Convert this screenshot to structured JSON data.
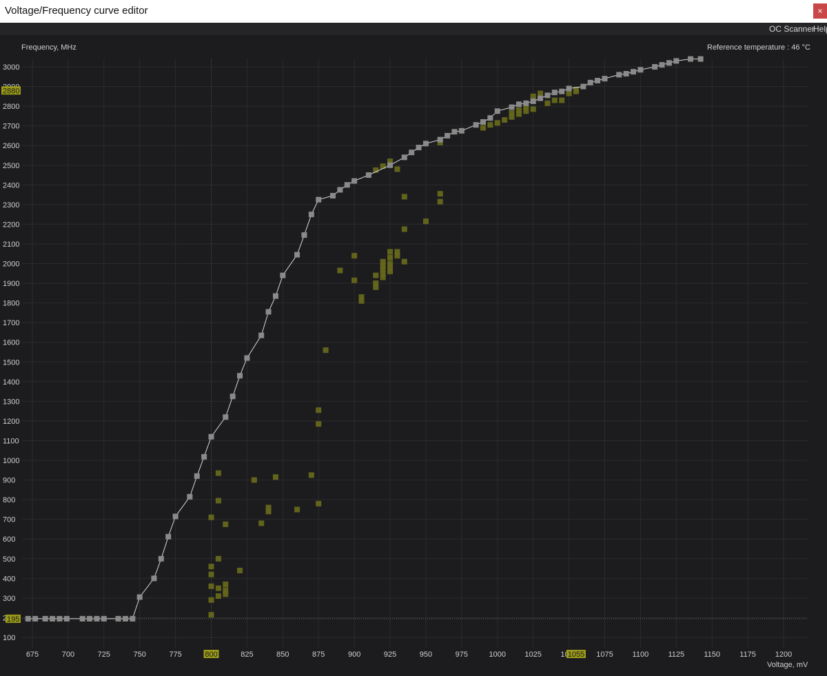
{
  "window": {
    "title": "Voltage/Frequency curve editor",
    "close_label": "×"
  },
  "menu": {
    "items": [
      "OC Scanner",
      "Help"
    ]
  },
  "chart_data": {
    "type": "scatter",
    "ylabel": "Frequency, MHz",
    "xlabel": "Voltage, mV",
    "reference_temperature_label": "Reference temperature :",
    "reference_temperature_value": "46 °C",
    "xlim": [
      667,
      1212
    ],
    "ylim": [
      55,
      3050
    ],
    "x_ticks": [
      675,
      700,
      725,
      750,
      775,
      800,
      825,
      850,
      875,
      900,
      925,
      950,
      975,
      1000,
      1025,
      1050,
      1075,
      1100,
      1125,
      1150,
      1175,
      1200
    ],
    "y_ticks": [
      100,
      200,
      300,
      400,
      500,
      600,
      700,
      800,
      900,
      1000,
      1100,
      1200,
      1300,
      1400,
      1500,
      1600,
      1700,
      1800,
      1900,
      2000,
      2100,
      2200,
      2300,
      2400,
      2500,
      2600,
      2700,
      2800,
      2900,
      3000
    ],
    "grid": true,
    "markers": {
      "x_value": 800,
      "x_value_label": "800",
      "x_value_2": 1055,
      "x_value_2_label": "1055",
      "y_value": 195,
      "y_value_label": "195",
      "y_value_2": 2880,
      "y_value_2_label": "2880"
    },
    "colors": {
      "curve_line": "#d8d8d8",
      "curve_points": "#8a8a8a",
      "history_points": "#66681c",
      "marker_label": "#9c9c1a",
      "grid": "#2b2b2e",
      "tick_text": "#cfcfcf"
    },
    "series": [
      {
        "name": "",
        "role": "curve",
        "points": [
          [
            672,
            195
          ],
          [
            677,
            195
          ],
          [
            684,
            195
          ],
          [
            689,
            195
          ],
          [
            694,
            195
          ],
          [
            699,
            195
          ],
          [
            710,
            195
          ],
          [
            715,
            195
          ],
          [
            720,
            195
          ],
          [
            725,
            195
          ],
          [
            735,
            195
          ],
          [
            740,
            195
          ],
          [
            745,
            195
          ],
          [
            750,
            305
          ],
          [
            760,
            400
          ],
          [
            765,
            500
          ],
          [
            770,
            612
          ],
          [
            775,
            715
          ],
          [
            785,
            815
          ],
          [
            790,
            920
          ],
          [
            795,
            1018
          ],
          [
            800,
            1120
          ],
          [
            810,
            1220
          ],
          [
            815,
            1325
          ],
          [
            820,
            1430
          ],
          [
            825,
            1520
          ],
          [
            835,
            1635
          ],
          [
            840,
            1755
          ],
          [
            845,
            1835
          ],
          [
            850,
            1940
          ],
          [
            860,
            2045
          ],
          [
            865,
            2145
          ],
          [
            870,
            2250
          ],
          [
            875,
            2325
          ],
          [
            885,
            2345
          ],
          [
            890,
            2375
          ],
          [
            895,
            2400
          ],
          [
            900,
            2420
          ],
          [
            910,
            2450
          ],
          [
            925,
            2500
          ],
          [
            935,
            2540
          ],
          [
            940,
            2565
          ],
          [
            945,
            2590
          ],
          [
            950,
            2610
          ],
          [
            960,
            2630
          ],
          [
            965,
            2650
          ],
          [
            970,
            2670
          ],
          [
            975,
            2675
          ],
          [
            985,
            2705
          ],
          [
            990,
            2720
          ],
          [
            995,
            2740
          ],
          [
            1000,
            2775
          ],
          [
            1010,
            2795
          ],
          [
            1015,
            2810
          ],
          [
            1020,
            2815
          ],
          [
            1025,
            2825
          ],
          [
            1030,
            2840
          ],
          [
            1035,
            2855
          ],
          [
            1040,
            2870
          ],
          [
            1045,
            2875
          ],
          [
            1050,
            2890
          ],
          [
            1060,
            2900
          ],
          [
            1065,
            2920
          ],
          [
            1070,
            2930
          ],
          [
            1075,
            2940
          ],
          [
            1085,
            2960
          ],
          [
            1090,
            2965
          ],
          [
            1095,
            2975
          ],
          [
            1100,
            2985
          ],
          [
            1110,
            3000
          ],
          [
            1115,
            3010
          ],
          [
            1120,
            3020
          ],
          [
            1125,
            3030
          ],
          [
            1135,
            3040
          ],
          [
            1142,
            3040
          ]
        ]
      },
      {
        "name": "",
        "role": "history",
        "points": [
          [
            800,
            460
          ],
          [
            800,
            420
          ],
          [
            800,
            360
          ],
          [
            800,
            290
          ],
          [
            800,
            215
          ],
          [
            800,
            710
          ],
          [
            805,
            935
          ],
          [
            805,
            795
          ],
          [
            805,
            500
          ],
          [
            805,
            350
          ],
          [
            805,
            310
          ],
          [
            810,
            675
          ],
          [
            810,
            370
          ],
          [
            810,
            340
          ],
          [
            810,
            320
          ],
          [
            820,
            440
          ],
          [
            830,
            900
          ],
          [
            835,
            680
          ],
          [
            840,
            760
          ],
          [
            840,
            740
          ],
          [
            845,
            915
          ],
          [
            860,
            750
          ],
          [
            870,
            925
          ],
          [
            875,
            1255
          ],
          [
            875,
            1185
          ],
          [
            875,
            780
          ],
          [
            880,
            1560
          ],
          [
            890,
            1965
          ],
          [
            900,
            2040
          ],
          [
            900,
            1915
          ],
          [
            905,
            1830
          ],
          [
            905,
            1810
          ],
          [
            915,
            1940
          ],
          [
            915,
            1900
          ],
          [
            915,
            1880
          ],
          [
            915,
            2475
          ],
          [
            920,
            2495
          ],
          [
            920,
            2010
          ],
          [
            920,
            1990
          ],
          [
            920,
            1970
          ],
          [
            920,
            1950
          ],
          [
            920,
            1930
          ],
          [
            925,
            2060
          ],
          [
            925,
            2030
          ],
          [
            925,
            2000
          ],
          [
            925,
            1980
          ],
          [
            925,
            1960
          ],
          [
            925,
            2520
          ],
          [
            925,
            2505
          ],
          [
            930,
            2060
          ],
          [
            930,
            2040
          ],
          [
            930,
            2480
          ],
          [
            935,
            2340
          ],
          [
            935,
            2175
          ],
          [
            935,
            2010
          ],
          [
            950,
            2215
          ],
          [
            960,
            2355
          ],
          [
            960,
            2315
          ],
          [
            960,
            2615
          ],
          [
            990,
            2690
          ],
          [
            995,
            2705
          ],
          [
            1000,
            2715
          ],
          [
            1005,
            2730
          ],
          [
            1010,
            2745
          ],
          [
            1010,
            2765
          ],
          [
            1015,
            2760
          ],
          [
            1015,
            2780
          ],
          [
            1020,
            2775
          ],
          [
            1020,
            2795
          ],
          [
            1025,
            2785
          ],
          [
            1025,
            2850
          ],
          [
            1030,
            2865
          ],
          [
            1035,
            2815
          ],
          [
            1040,
            2830
          ],
          [
            1045,
            2830
          ],
          [
            1050,
            2865
          ],
          [
            1055,
            2875
          ],
          [
            1055,
            2885
          ]
        ]
      }
    ]
  }
}
